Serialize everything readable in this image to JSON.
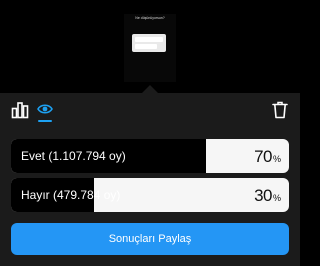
{
  "preview": {
    "caption": "Ne düşünüyorsun?"
  },
  "toolbar": {
    "results_icon": "bar-chart-icon",
    "viewers_icon": "eye-icon",
    "delete_icon": "trash-icon",
    "active_color": "#1da1f2"
  },
  "poll": {
    "options": [
      {
        "label": "Evet (1.107.794 oy)",
        "percent": 70,
        "percent_text": "70",
        "unit": "%"
      },
      {
        "label": "Hayır (479.784 oy)",
        "percent": 30,
        "percent_text": "30",
        "unit": "%"
      }
    ],
    "bar_fill_color": "#000000",
    "bar_track_color": "#f6f6f6"
  },
  "share_button": {
    "label": "Sonuçları Paylaş",
    "color": "#2496f5"
  }
}
